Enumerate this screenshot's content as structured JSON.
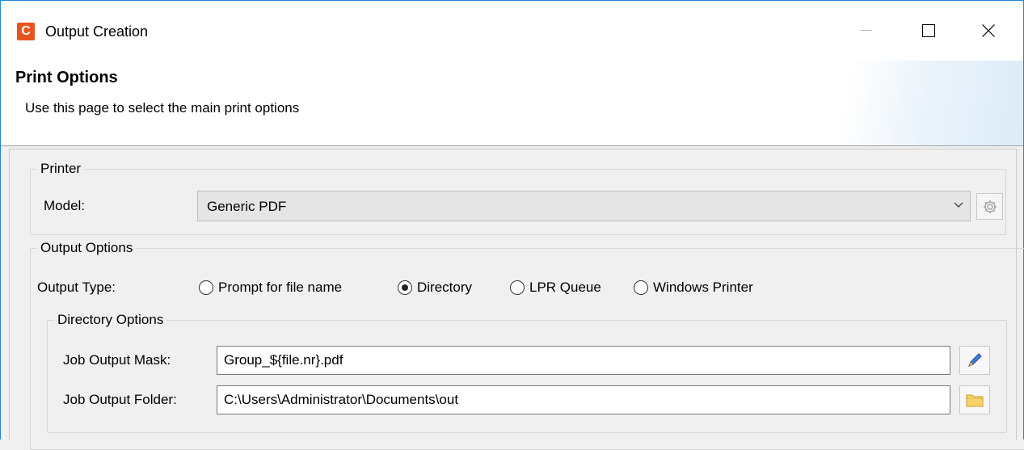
{
  "window": {
    "title": "Output Creation",
    "app_icon_letter": "C",
    "accent_color": "#e8541e"
  },
  "header": {
    "title": "Print Options",
    "subtitle": "Use this page to select the main print options"
  },
  "printer": {
    "legend": "Printer",
    "model_label": "Model:",
    "model_value": "Generic PDF"
  },
  "output_options": {
    "legend": "Output Options",
    "type_label": "Output Type:",
    "types": [
      {
        "label": "Prompt for file name",
        "selected": false
      },
      {
        "label": "Directory",
        "selected": true
      },
      {
        "label": "LPR Queue",
        "selected": false
      },
      {
        "label": "Windows Printer",
        "selected": false
      }
    ]
  },
  "directory_options": {
    "legend": "Directory Options",
    "mask_label": "Job Output Mask:",
    "mask_value": "Group_${file.nr}.pdf",
    "folder_label": "Job Output Folder:",
    "folder_value": "C:\\Users\\Administrator\\Documents\\out"
  },
  "icons": {
    "minimize": "minimize-icon",
    "maximize": "maximize-icon",
    "close": "close-icon",
    "dropdown": "chevron-down-icon",
    "settings": "gear-icon",
    "edit": "pencil-icon",
    "browse": "folder-icon"
  }
}
